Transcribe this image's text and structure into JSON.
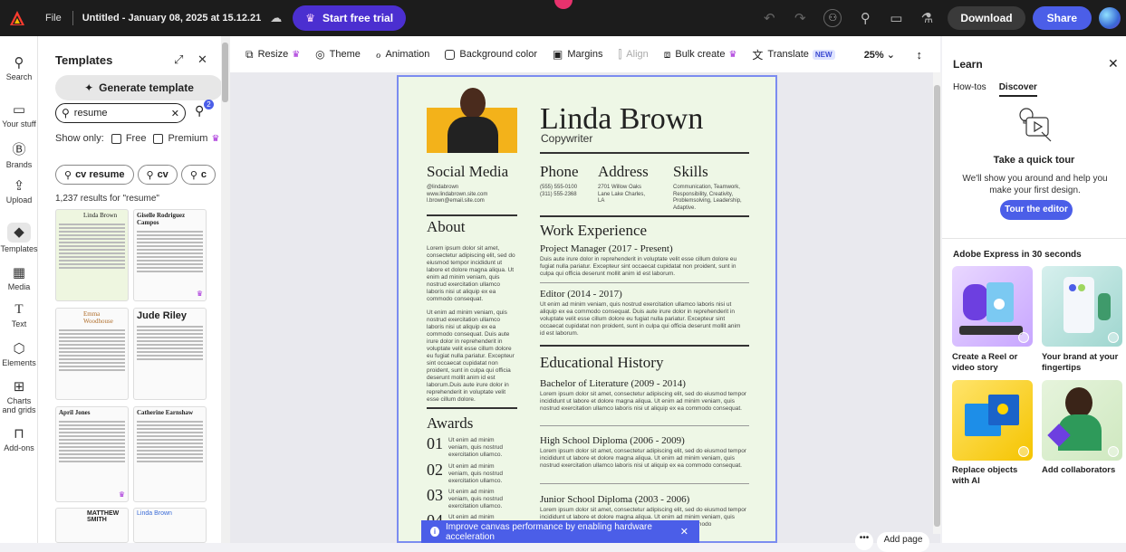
{
  "topbar": {
    "file_label": "File",
    "doc_title": "Untitled - January 08, 2025 at 15.12.21",
    "trial_label": "Start free trial",
    "download_label": "Download",
    "share_label": "Share"
  },
  "rail": {
    "items": [
      {
        "label": "Search",
        "icon": "search-icon"
      },
      {
        "label": "Your stuff",
        "icon": "folder-icon"
      },
      {
        "label": "Brands",
        "icon": "brand-icon"
      },
      {
        "label": "Upload",
        "icon": "upload-icon"
      },
      {
        "label": "Templates",
        "icon": "templates-icon"
      },
      {
        "label": "Media",
        "icon": "media-icon"
      },
      {
        "label": "Text",
        "icon": "text-icon"
      },
      {
        "label": "Elements",
        "icon": "elements-icon"
      },
      {
        "label": "Charts and grids",
        "icon": "grid-icon"
      },
      {
        "label": "Add-ons",
        "icon": "addons-icon"
      }
    ]
  },
  "templates": {
    "title": "Templates",
    "generate_label": "Generate template",
    "search_value": "resume",
    "filter_badge": "2",
    "show_only": "Show only:",
    "free_label": "Free",
    "premium_label": "Premium",
    "chips": [
      "cv resume",
      "cv",
      "c"
    ],
    "results": "1,237 results for \"resume\"",
    "thumbs": [
      "Linda Brown",
      "Giselle Rodriguez Campos",
      "Emma Woodhouse",
      "Jude Riley",
      "April Jones",
      "Catherine Earnshaw",
      "MATTHEW SMITH",
      "Linda Brown"
    ]
  },
  "toolbar": {
    "resize": "Resize",
    "theme": "Theme",
    "animation": "Animation",
    "bg_color": "Background color",
    "margins": "Margins",
    "align": "Align",
    "bulk": "Bulk create",
    "translate": "Translate",
    "new_badge": "NEW",
    "zoom": "25%"
  },
  "resume": {
    "name": "Linda Brown",
    "job": "Copywriter",
    "social_h": "Social Media",
    "social": "@lindabrown\nwww.lindabrown.site.com\nl.brown@email.site.com",
    "phone_h": "Phone",
    "phone": "(555) 555-0100\n(311) 555-2368",
    "address_h": "Address",
    "address": "2701 Willow Oaks\nLane Lake Charles,\nLA",
    "skills_h": "Skills",
    "skills": "Communication, Teamwork,\nResponsibility, Creativity,\nProblemsolving, Leadership,\nAdaptive.",
    "about_h": "About",
    "about1": "Lorem ipsum dolor sit amet, consectetur adipiscing elit, sed do eiusmod tempor incididunt ut labore et dolore magna aliqua. Ut enim ad minim veniam, quis nostrud exercitation ullamco laboris nisi ut aliquip ex ea commodo consequat.",
    "about2": "Ut enim ad minim veniam, quis nostrud exercitation ullamco laboris nisi ut aliquip ex ea commodo consequat. Duis aute irure dolor in reprehenderit in voluptate velit esse cillum dolore eu fugiat nulla pariatur. Excepteur sint occaecat cupidatat non proident, sunt in culpa qui officia deserunt mollit anim id est laborum.Duis aute irure dolor in reprehenderit in voluptate velit esse cillum dolore.",
    "work_h": "Work Experience",
    "job1": "Project Manager (2017 - Present)",
    "job1_text": "Duis aute irure dolor in reprehenderit in voluptate velit esse cillum dolore eu fugiat nulla pariatur. Excepteur sint occaecat cupidatat non proident, sunt in culpa qui officia deserunt mollit anim id est laborum.",
    "job2": "Editor (2014 - 2017)",
    "job2_text": "Ut enim ad minim veniam, quis nostrud exercitation ullamco laboris nisi ut aliquip ex ea commodo consequat. Duis aute irure dolor in reprehenderit in voluptate velit esse cillum dolore eu fugiat nulla pariatur. Excepteur sint occaecat cupidatat non proident, sunt in culpa qui officia deserunt mollit anim id est laborum.",
    "edu_h": "Educational History",
    "edu1": "Bachelor of Literature (2009 - 2014)",
    "edu1_text": "Lorem ipsum dolor sit amet, consectetur adipiscing elit, sed do eiusmod tempor incididunt ut labore et dolore magna aliqua. Ut enim ad minim veniam, quis nostrud exercitation ullamco laboris nisi ut aliquip ex ea commodo consequat.",
    "edu2": "High School Diploma (2006 - 2009)",
    "edu2_text": "Lorem ipsum dolor sit amet, consectetur adipiscing elit, sed do eiusmod tempor incididunt ut labore et dolore magna aliqua. Ut enim ad minim veniam, quis nostrud exercitation ullamco laboris nisi ut aliquip ex ea commodo consequat.",
    "edu3": "Junior School Diploma (2003 - 2006)",
    "edu3_text": "Lorem ipsum dolor sit amet, consectetur adipiscing elit, sed do eiusmod tempor incididunt ut labore et dolore magna aliqua. Ut enim ad minim veniam, quis nostrud exercitation ullamco laboris nisi ut aliquip ex ea commodo",
    "awards_h": "Awards",
    "award_text": "Ut enim ad minim veniam, quis nostrud exercitation ullamco.",
    "award_nums": [
      "01",
      "02",
      "03",
      "04"
    ]
  },
  "notice": {
    "text": "Improve canvas performance by enabling hardware acceleration",
    "add_page": "Add page"
  },
  "learn": {
    "title": "Learn",
    "tab_howtos": "How-tos",
    "tab_discover": "Discover",
    "tour_title": "Take a quick tour",
    "tour_desc": "We'll show you around and help you make your first design.",
    "tour_btn": "Tour the editor",
    "ae30": "Adobe Express in 30 seconds",
    "cards": [
      "Create a Reel or video story",
      "Your brand at your fingertips",
      "Replace objects with AI",
      "Add collaborators"
    ]
  }
}
